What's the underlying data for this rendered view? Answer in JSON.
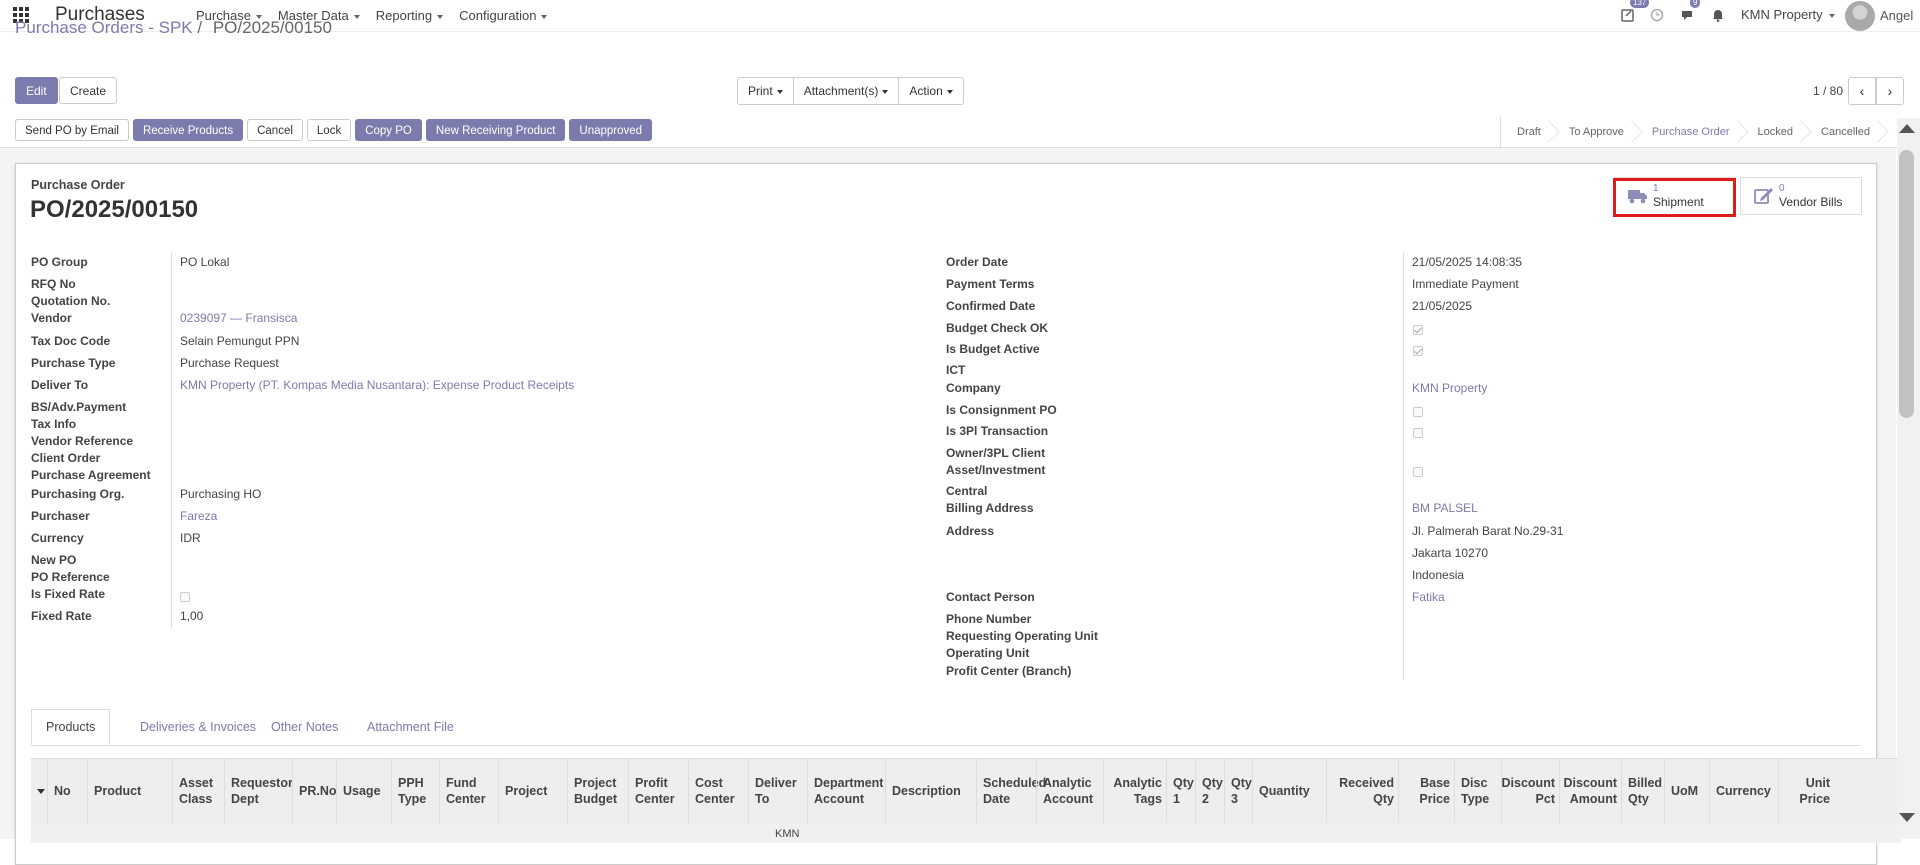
{
  "navbar": {
    "brand": "Purchases",
    "menu": [
      "Purchase",
      "Master Data",
      "Reporting",
      "Configuration"
    ],
    "activity_badge": "137",
    "chat_badge": "9",
    "company": "KMN Property",
    "username": "Angel"
  },
  "control_panel": {
    "breadcrumb_parent": "Purchase Orders - SPK",
    "breadcrumb_sep": "/",
    "breadcrumb_current": "PO/2025/00150",
    "edit_label": "Edit",
    "create_label": "Create",
    "print_label": "Print",
    "attachments_label": "Attachment(s)",
    "action_label": "Action",
    "pager": "1 / 80",
    "prev_icon": "‹",
    "next_icon": "›"
  },
  "statusbar": {
    "buttons": [
      "Send PO by Email",
      "Receive Products",
      "Cancel",
      "Lock",
      "Copy PO",
      "New Receiving Product",
      "Unapproved"
    ],
    "states": [
      "Draft",
      "To Approve",
      "Purchase Order",
      "Locked",
      "Cancelled"
    ],
    "active_state": "Purchase Order"
  },
  "form": {
    "doc_label": "Purchase Order",
    "doc_name": "PO/2025/00150",
    "smart_buttons": {
      "shipment_count": "1",
      "shipment_label": "Shipment",
      "bills_count": "0",
      "bills_label": "Vendor Bills"
    },
    "left": {
      "po_group_label": "PO Group",
      "po_group": "PO Lokal",
      "rfq_label": "RFQ No",
      "quotation_label": "Quotation No.",
      "vendor_label": "Vendor",
      "vendor": "0239097 — Fransisca",
      "tax_doc_label": "Tax Doc Code",
      "tax_doc": "Selain Pemungut PPN",
      "purchase_type_label": "Purchase Type",
      "purchase_type": "Purchase Request",
      "deliver_to_label": "Deliver To",
      "deliver_to": "KMN Property (PT. Kompas Media Nusantara): Expense Product Receipts",
      "bs_adv_label": "BS/Adv.Payment",
      "tax_info_label": "Tax Info",
      "vendor_ref_label": "Vendor Reference",
      "client_order_label": "Client Order",
      "purchase_agreement_label": "Purchase Agreement",
      "purchasing_org_label": "Purchasing Org.",
      "purchasing_org": "Purchasing HO",
      "purchaser_label": "Purchaser",
      "purchaser": "Fareza",
      "currency_label": "Currency",
      "currency": "IDR",
      "new_po_label": "New PO",
      "po_reference_label": "PO Reference",
      "is_fixed_rate_label": "Is Fixed Rate",
      "fixed_rate_label": "Fixed Rate",
      "fixed_rate": "1,00"
    },
    "right": {
      "order_date_label": "Order Date",
      "order_date": "21/05/2025 14:08:35",
      "payment_terms_label": "Payment Terms",
      "payment_terms": "Immediate Payment",
      "confirmed_date_label": "Confirmed Date",
      "confirmed_date": "21/05/2025",
      "budget_check_label": "Budget Check OK",
      "is_budget_active_label": "Is Budget Active",
      "ict_label": "ICT",
      "company_label": "Company",
      "company": "KMN Property",
      "is_consignment_label": "Is Consignment PO",
      "is_3pl_label": "Is 3Pl Transaction",
      "owner_3pl_label": "Owner/3PL Client",
      "asset_investment_label": "Asset/Investment",
      "central_label": "Central",
      "billing_address_label": "Billing Address",
      "billing_address": "BM PALSEL",
      "address_label": "Address",
      "address_line1": "Jl. Palmerah Barat No.29-31",
      "address_line2": "Jakarta  10270",
      "address_line3": "Indonesia",
      "contact_person_label": "Contact Person",
      "contact_person": "Fatika",
      "phone_label": "Phone Number",
      "req_op_unit_label": "Requesting Operating Unit",
      "op_unit_label": "Operating Unit",
      "profit_center_label": "Profit Center (Branch)"
    },
    "checkbox_values": {
      "budget_check_ok": true,
      "is_budget_active": true,
      "is_consignment_po": false,
      "is_3pl_transaction": false,
      "asset_investment": false,
      "is_fixed_rate": false
    }
  },
  "tabs": [
    "Products",
    "Deliveries & Invoices",
    "Other Notes",
    "Attachment File"
  ],
  "table": {
    "columns": [
      "No",
      "Product",
      "Asset Class",
      "Requestor Dept",
      "PR.No",
      "Usage",
      "PPH Type",
      "Fund Center",
      "Project",
      "Project Budget",
      "Profit Center",
      "Cost Center",
      "Deliver To",
      "Department Account",
      "Description",
      "Scheduled Date",
      "Analytic Account",
      "Analytic Tags",
      "Qty 1",
      "Qty 2",
      "Qty 3",
      "Quantity",
      "Received Qty",
      "Base Price",
      "Disc Type",
      "Discount Pct",
      "Discount Amount",
      "Billed Qty",
      "UoM",
      "Currency",
      "Unit Price"
    ],
    "first_row_deliver_to": "KMN"
  }
}
